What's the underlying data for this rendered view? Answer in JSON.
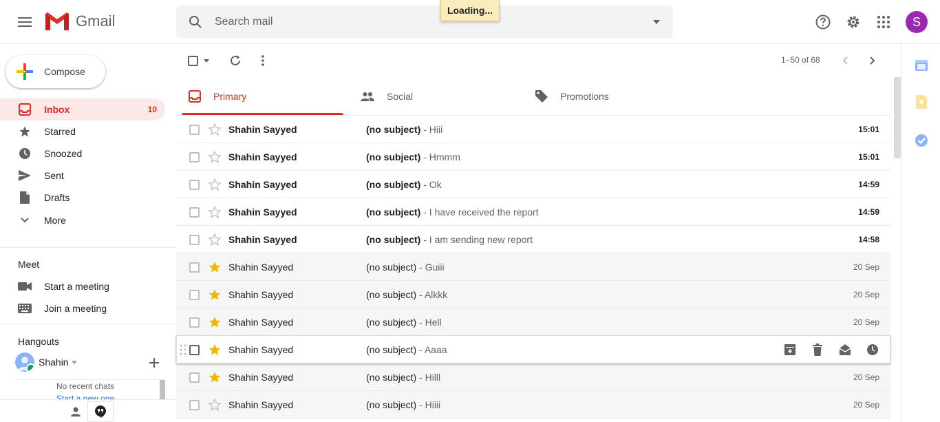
{
  "app": {
    "name": "Gmail"
  },
  "header": {
    "search_placeholder": "Search mail",
    "loading_text": "Loading...",
    "avatar_letter": "S"
  },
  "compose": {
    "label": "Compose"
  },
  "nav": {
    "items": [
      {
        "label": "Inbox",
        "count": "10",
        "icon": "inbox-icon",
        "active": true
      },
      {
        "label": "Starred",
        "icon": "star-icon"
      },
      {
        "label": "Snoozed",
        "icon": "clock-icon"
      },
      {
        "label": "Sent",
        "icon": "send-icon"
      },
      {
        "label": "Drafts",
        "icon": "draft-icon"
      },
      {
        "label": "More",
        "icon": "chevron-down-icon"
      }
    ]
  },
  "meet": {
    "title": "Meet",
    "start": "Start a meeting",
    "join": "Join a meeting"
  },
  "hangouts": {
    "title": "Hangouts",
    "user": "Shahin",
    "no_chats": "No recent chats",
    "start_new": "Start a new one"
  },
  "toolbar": {
    "page_count": "1–50 of 68"
  },
  "tabs": [
    {
      "label": "Primary",
      "icon": "inbox-icon",
      "active": true
    },
    {
      "label": "Social",
      "icon": "people-icon"
    },
    {
      "label": "Promotions",
      "icon": "tag-icon"
    }
  ],
  "emails": [
    {
      "sender": "Shahin Sayyed",
      "subject": "(no subject)",
      "snippet": " - Hiii",
      "time": "15:01",
      "unread": true,
      "starred": false
    },
    {
      "sender": "Shahin Sayyed",
      "subject": "(no subject)",
      "snippet": " - Hmmm",
      "time": "15:01",
      "unread": true,
      "starred": false
    },
    {
      "sender": "Shahin Sayyed",
      "subject": "(no subject)",
      "snippet": " - Ok",
      "time": "14:59",
      "unread": true,
      "starred": false
    },
    {
      "sender": "Shahin Sayyed",
      "subject": "(no subject)",
      "snippet": " - I have received the report",
      "time": "14:59",
      "unread": true,
      "starred": false
    },
    {
      "sender": "Shahin Sayyed",
      "subject": "(no subject)",
      "snippet": " - I am sending new report",
      "time": "14:58",
      "unread": true,
      "starred": false
    },
    {
      "sender": "Shahin Sayyed",
      "subject": "(no subject)",
      "snippet": " - Guiii",
      "time": "20 Sep",
      "unread": false,
      "starred": true
    },
    {
      "sender": "Shahin Sayyed",
      "subject": "(no subject)",
      "snippet": " - Alkkk",
      "time": "20 Sep",
      "unread": false,
      "starred": true
    },
    {
      "sender": "Shahin Sayyed",
      "subject": "(no subject)",
      "snippet": " - Hell",
      "time": "20 Sep",
      "unread": false,
      "starred": true
    },
    {
      "sender": "Shahin Sayyed",
      "subject": "(no subject)",
      "snippet": " - Aaaa",
      "time": "",
      "unread": false,
      "starred": true,
      "hover": true
    },
    {
      "sender": "Shahin Sayyed",
      "subject": "(no subject)",
      "snippet": " - Hilll",
      "time": "20 Sep",
      "unread": false,
      "starred": true
    },
    {
      "sender": "Shahin Sayyed",
      "subject": "(no subject)",
      "snippet": " - Hiiii",
      "time": "20 Sep",
      "unread": false,
      "starred": false
    }
  ],
  "colors": {
    "accent_red": "#d93025",
    "star_yellow": "#f4b400",
    "avatar_purple": "#9c27b0"
  }
}
